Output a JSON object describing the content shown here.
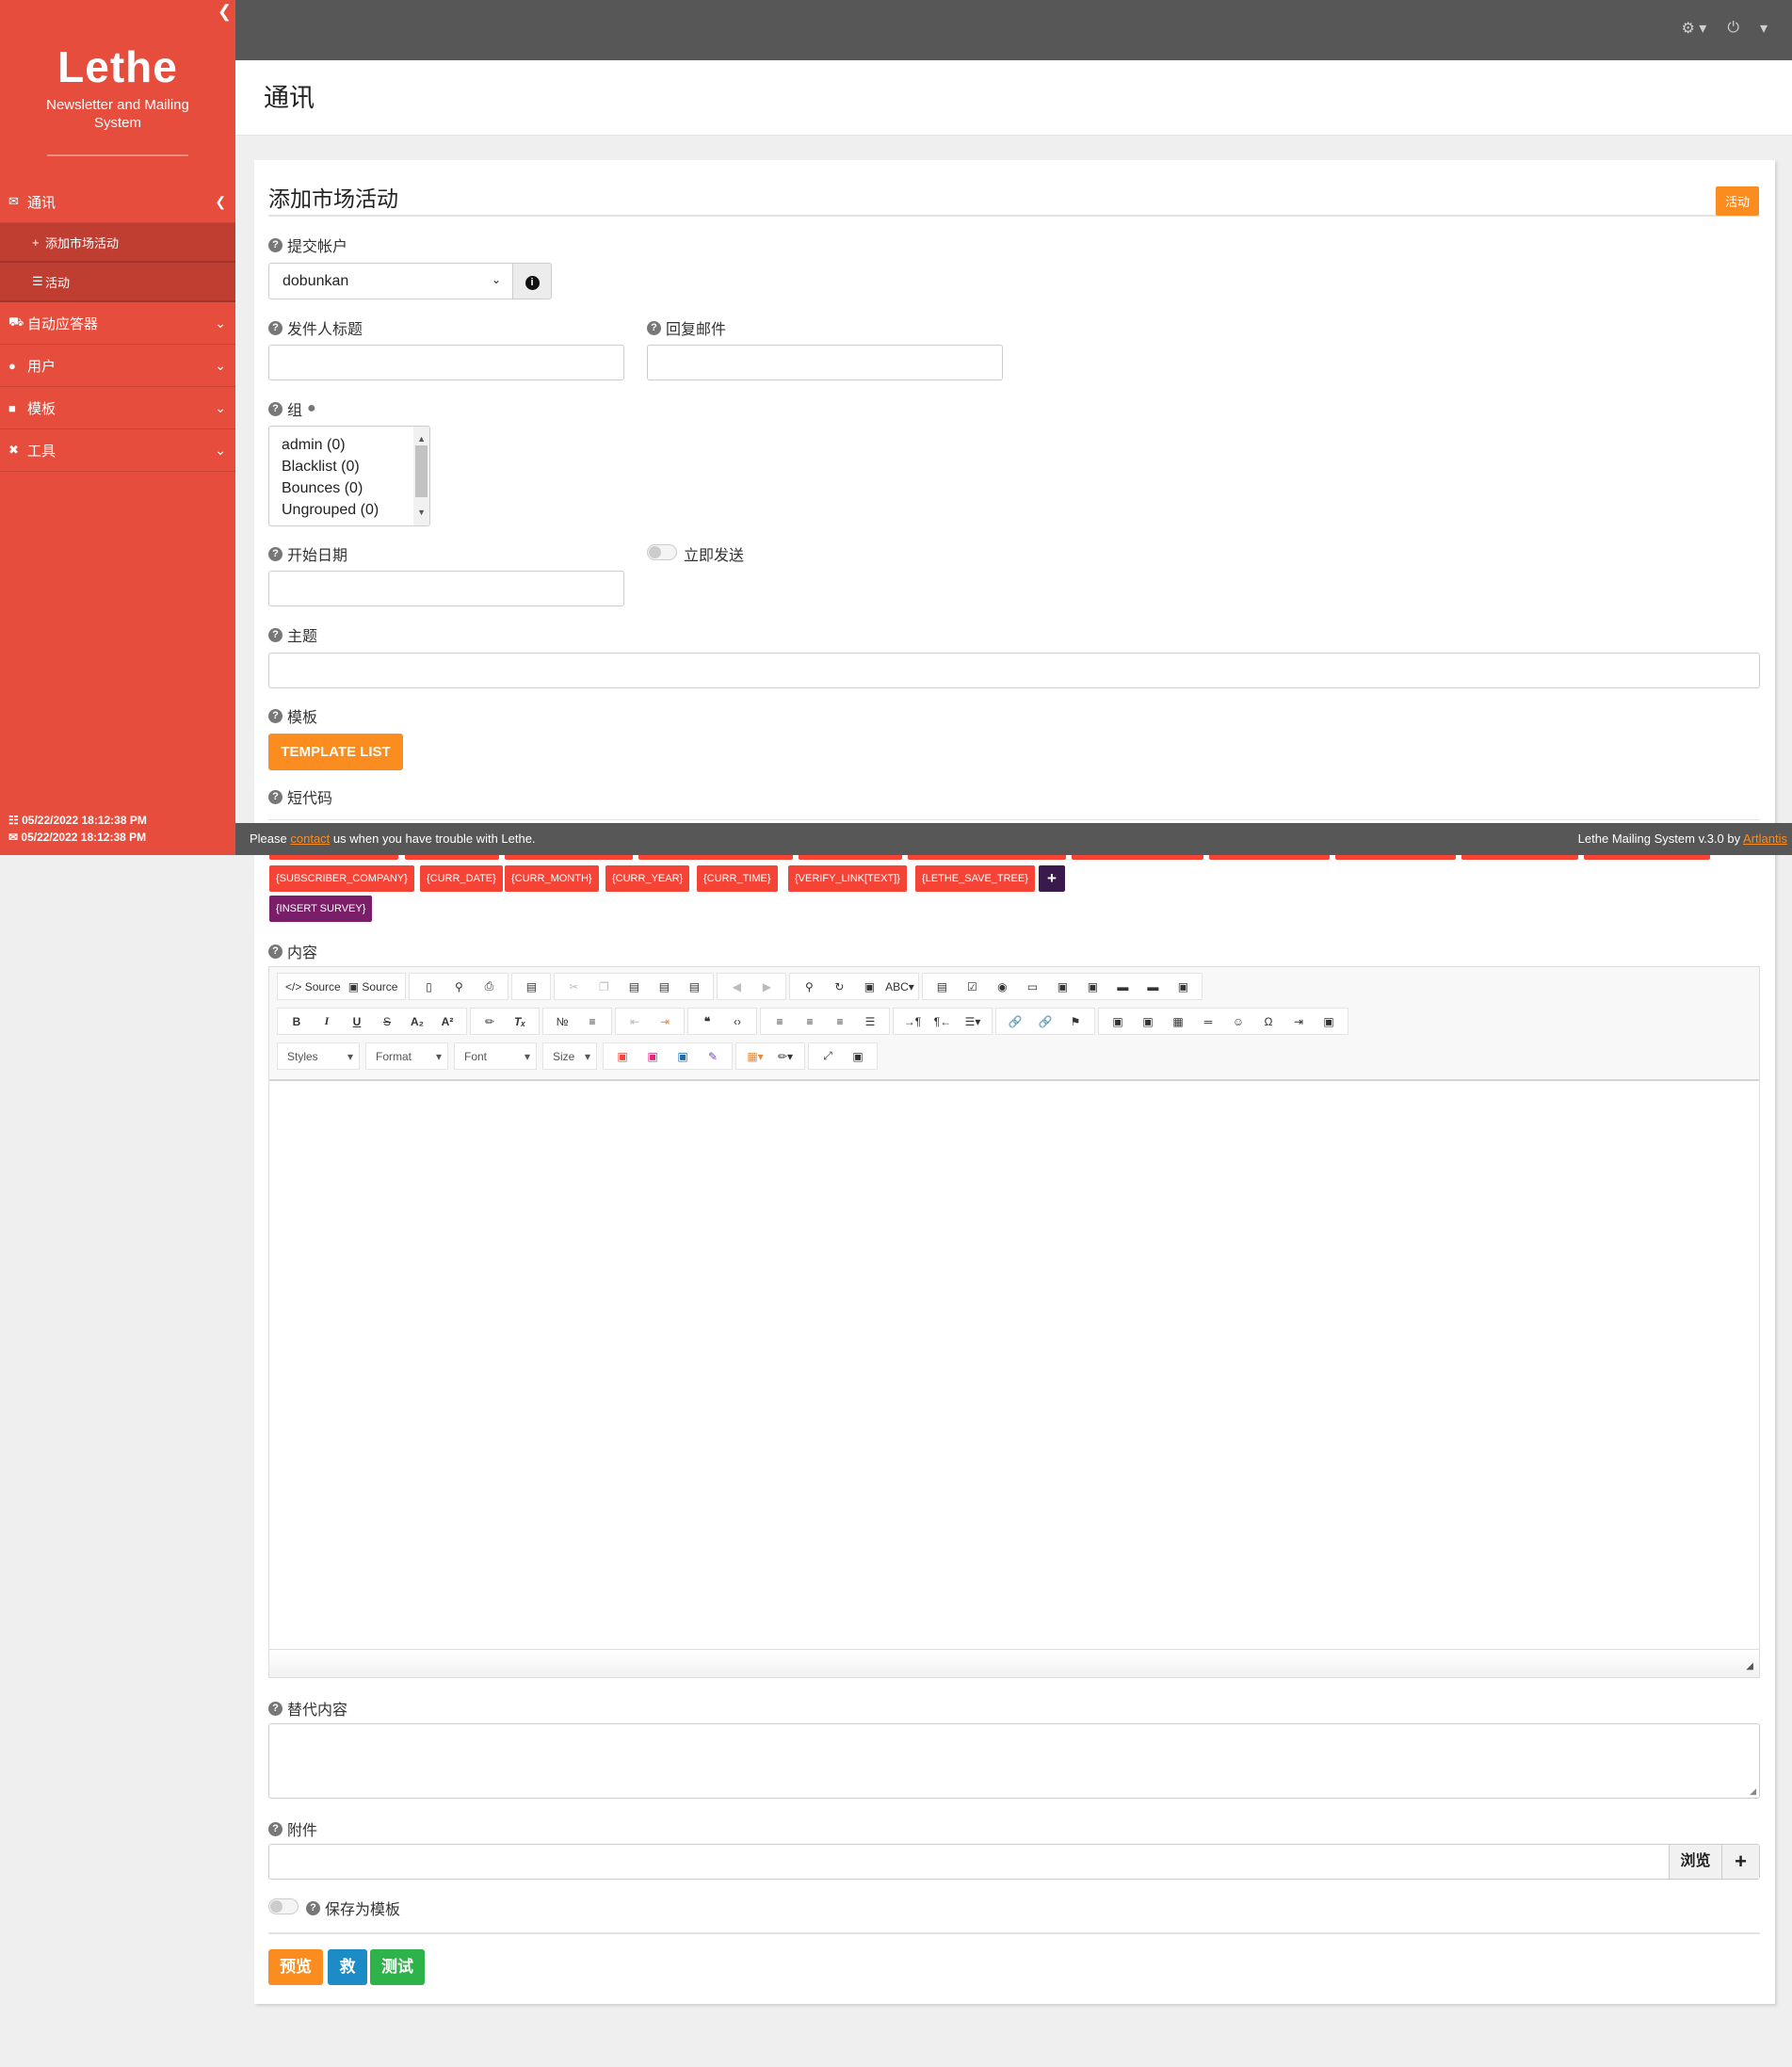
{
  "sidebar": {
    "collapse_icon": "chevron-left",
    "logo_title": "Lethe",
    "logo_subtitle": "Newsletter and Mailing System",
    "nav": [
      {
        "icon": "envelope",
        "label": "通讯",
        "expanded": true
      },
      {
        "icon": "truck",
        "label": "自动应答器"
      },
      {
        "icon": "users",
        "label": "用户"
      },
      {
        "icon": "paint-roller",
        "label": "模板"
      },
      {
        "icon": "tools",
        "label": "工具"
      }
    ],
    "sub_items": [
      {
        "icon": "plus",
        "label": "添加市场活动"
      },
      {
        "icon": "list",
        "label": "活动"
      }
    ],
    "time1": "05/22/2022 18:12:38 PM",
    "time2": "05/22/2022 18:12:38 PM"
  },
  "topbar": {
    "icons": [
      "gear-icon",
      "power-icon",
      "caret-icon"
    ]
  },
  "page": {
    "title": "通讯"
  },
  "panel": {
    "title": "添加市场活动",
    "campaigns_button": "活动",
    "submission_account_label": "提交帐户",
    "submission_account_value": "dobunkan",
    "sender_title_label": "发件人标题",
    "reply_mail_label": "回复邮件",
    "groups_label": "组",
    "groups": [
      "admin (0)",
      "Blacklist (0)",
      "Bounces (0)",
      "Ungrouped (0)"
    ],
    "start_date_label": "开始日期",
    "send_now_label": "立即发送",
    "subject_label": "主题",
    "template_label": "模板",
    "template_button": "TEMPLATE LIST",
    "shortcodes_label": "短代码",
    "shortcodes_row2": [
      "{SUBSCRIBER_COMPANY}",
      "{CURR_DATE}",
      "{CURR_MONTH}",
      "{CURR_YEAR}",
      "{CURR_TIME}",
      "{VERIFY_LINK[TEXT]}",
      "{LETHE_SAVE_TREE}"
    ],
    "shortcode_add": "+",
    "shortcode_survey": "{INSERT SURVEY}",
    "content_label": "内容",
    "editor": {
      "source1": "Source",
      "source2": "Source",
      "styles": "Styles",
      "format": "Format",
      "font": "Font",
      "size": "Size"
    },
    "alt_content_label": "替代内容",
    "attachment_label": "附件",
    "browse_button": "浏览",
    "attach_add": "+",
    "save_template_label": "保存为模板",
    "preview_button": "预览",
    "save_button": "救",
    "test_button": "测试"
  },
  "footer": {
    "left_prefix": "Please ",
    "left_link": "contact",
    "left_suffix": " us when you have trouble with Lethe.",
    "right_prefix": "Lethe Mailing System v.3.0 by ",
    "right_link": "Artlantis"
  },
  "colors": {
    "sidebar": "#e64d3d",
    "accent": "#fb8c1f",
    "tag": "#f54336",
    "topbar": "#575757",
    "save": "#1c8bc6",
    "test": "#2db34a"
  }
}
